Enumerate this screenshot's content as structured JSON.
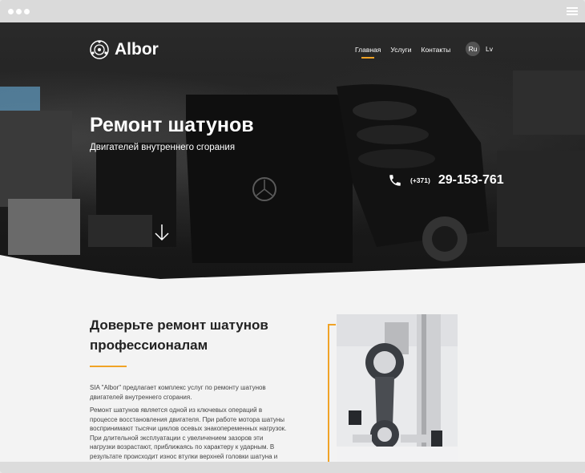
{
  "brand": {
    "name": "Albor"
  },
  "nav": {
    "items": [
      "Главная",
      "Услуги",
      "Контакты"
    ],
    "active_index": 0
  },
  "lang": {
    "items": [
      "Ru",
      "Lv"
    ],
    "active_index": 0
  },
  "hero": {
    "title": "Ремонт шатунов",
    "subtitle": "Двигателей внутреннего сгорания",
    "phone_code": "(+371)",
    "phone_number": "29-153-761"
  },
  "content": {
    "title": "Доверьте ремонт шатунов профессионалам",
    "paragraph1": "SIA \"Albor\" предлагает комплекс услуг по ремонту шатунов двигателей внутреннего сгорания.",
    "paragraph2": "Ремонт шатунов является одной из ключевых операций в процессе восстановления двигателя. При работе мотора шатуны воспринимают тысячи циклов осевых знакопеременных нагрузок. При длительной эксплуатации с увеличением зазоров эти нагрузки возрастают, приближаясь по характеру к ударным. В результате происходит износ втулки верхней головки шатуна и деформация"
  },
  "colors": {
    "accent": "#f0a326",
    "hero_bg": "#1c1c1c",
    "page_bg": "#f3f3f3"
  },
  "icons": [
    "logo-icon",
    "phone-icon",
    "arrow-down-icon",
    "hamburger-icon"
  ]
}
